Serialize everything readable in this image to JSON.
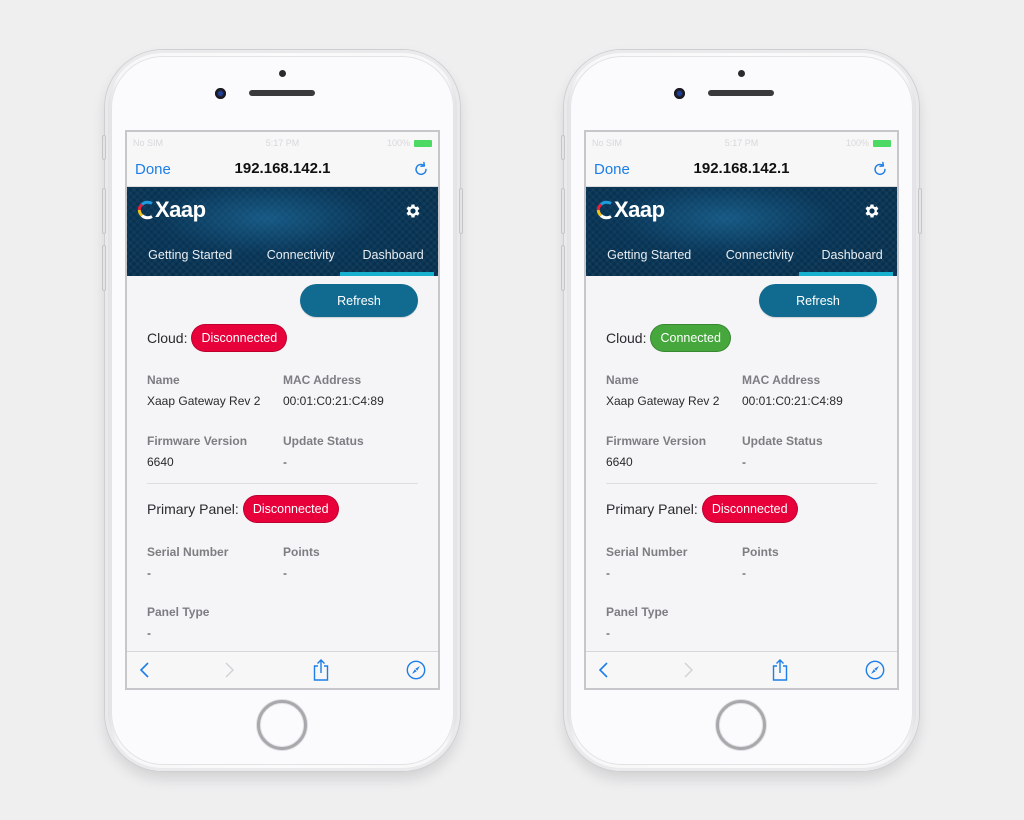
{
  "phones": [
    {
      "id": "left",
      "status_bar": {
        "carrier": "No SIM",
        "time": "5:17 PM",
        "battery": "100%"
      },
      "browser": {
        "done_label": "Done",
        "url": "192.168.142.1"
      },
      "app": {
        "logo_text": "Xaap",
        "tabs": [
          {
            "label": "Getting Started",
            "active": false
          },
          {
            "label": "Connectivity",
            "active": false
          },
          {
            "label": "Dashboard",
            "active": true
          }
        ],
        "refresh_label": "Refresh",
        "cloud": {
          "label": "Cloud:",
          "status": "Disconnected",
          "color": "#e8003a"
        },
        "gateway": {
          "name_label": "Name",
          "name_value": "Xaap Gateway Rev 2",
          "mac_label": "MAC Address",
          "mac_value": "00:01:C0:21:C4:89",
          "firmware_label": "Firmware Version",
          "firmware_value": "6640",
          "update_label": "Update Status",
          "update_value": "-"
        },
        "primary_panel": {
          "label": "Primary Panel:",
          "status": "Disconnected",
          "color": "#e8003a"
        },
        "panel": {
          "serial_label": "Serial Number",
          "serial_value": "-",
          "points_label": "Points",
          "points_value": "-",
          "type_label": "Panel Type",
          "type_value": "-"
        }
      }
    },
    {
      "id": "right",
      "status_bar": {
        "carrier": "No SIM",
        "time": "5:17 PM",
        "battery": "100%"
      },
      "browser": {
        "done_label": "Done",
        "url": "192.168.142.1"
      },
      "app": {
        "logo_text": "Xaap",
        "tabs": [
          {
            "label": "Getting Started",
            "active": false
          },
          {
            "label": "Connectivity",
            "active": false
          },
          {
            "label": "Dashboard",
            "active": true
          }
        ],
        "refresh_label": "Refresh",
        "cloud": {
          "label": "Cloud:",
          "status": "Connected",
          "color": "#45a73c"
        },
        "gateway": {
          "name_label": "Name",
          "name_value": "Xaap Gateway Rev 2",
          "mac_label": "MAC Address",
          "mac_value": "00:01:C0:21:C4:89",
          "firmware_label": "Firmware Version",
          "firmware_value": "6640",
          "update_label": "Update Status",
          "update_value": "-"
        },
        "primary_panel": {
          "label": "Primary Panel:",
          "status": "Disconnected",
          "color": "#e8003a"
        },
        "panel": {
          "serial_label": "Serial Number",
          "serial_value": "-",
          "points_label": "Points",
          "points_value": "-",
          "type_label": "Panel Type",
          "type_value": "-"
        }
      }
    }
  ],
  "colors": {
    "ios_blue": "#1c7ee6",
    "header_bg": "#06304e",
    "tab_underline": "#18b0cf",
    "refresh_button": "#116b91",
    "disconnected": "#e8003a",
    "connected": "#45a73c"
  },
  "icons": {
    "reload": "reload-icon",
    "settings": "gear-icon",
    "back": "chevron-left-icon",
    "forward": "chevron-right-icon",
    "share": "share-icon",
    "safari": "compass-icon"
  }
}
